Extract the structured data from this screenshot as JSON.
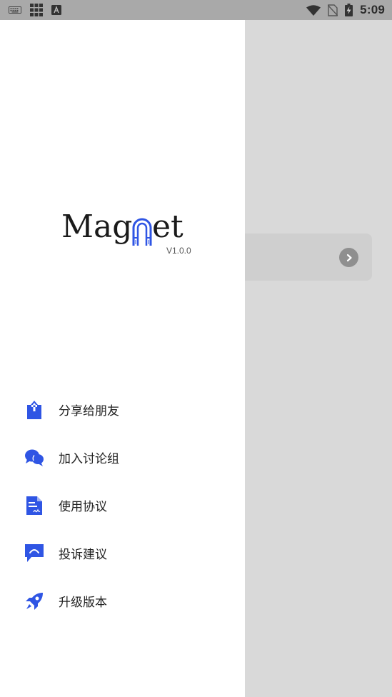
{
  "status_bar": {
    "time": "5:09",
    "left_icons": [
      "keyboard-icon",
      "apps-grid-icon",
      "a-badge-icon"
    ],
    "right_icons": [
      "wifi-icon",
      "no-sim-icon",
      "battery-charging-icon"
    ]
  },
  "drawer": {
    "logo": {
      "part_left": "Mag",
      "part_right": "et",
      "icon": "magnet-icon"
    },
    "version": "V1.0.0",
    "menu": [
      {
        "label": "分享给朋友",
        "icon": "share-icon"
      },
      {
        "label": "加入讨论组",
        "icon": "chat-bubbles-icon"
      },
      {
        "label": "使用协议",
        "icon": "document-icon"
      },
      {
        "label": "投诉建议",
        "icon": "feedback-icon"
      },
      {
        "label": "升级版本",
        "icon": "rocket-icon"
      }
    ]
  },
  "background_page": {
    "card_icon": "chevron-right-icon"
  },
  "colors": {
    "accent": "#2f55e4",
    "drawer_bg": "#ffffff",
    "scrim_bg": "#d9d9d9",
    "status_bar_bg": "#a9a9a9"
  }
}
